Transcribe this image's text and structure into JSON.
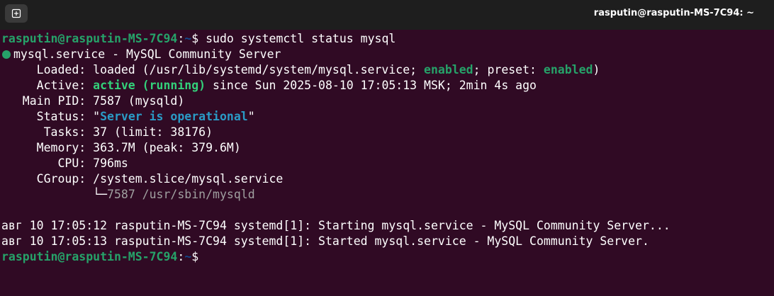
{
  "window": {
    "title": "rasputin@rasputin-MS-7C94: ~"
  },
  "prompt": {
    "user_host": "rasputin@rasputin-MS-7C94",
    "separator": ":",
    "path": "~",
    "symbol": "$"
  },
  "command": " sudo systemctl status mysql",
  "status": {
    "unit_line": "mysql.service - MySQL Community Server",
    "loaded_label": "     Loaded: ",
    "loaded_prefix": "loaded (/usr/lib/systemd/system/mysql.service; ",
    "loaded_enabled": "enabled",
    "loaded_mid": "; preset: ",
    "loaded_preset": "enabled",
    "loaded_suffix": ")",
    "active_label": "     Active: ",
    "active_value": "active (running)",
    "active_suffix": " since Sun 2025-08-10 17:05:13 MSK; 2min 4s ago",
    "main_pid_line": "   Main PID: 7587 (mysqld)",
    "status_label": "     Status: ",
    "status_quote_open": "\"",
    "status_value": "Server is operational",
    "status_quote_close": "\"",
    "tasks_line": "      Tasks: 37 (limit: 38176)",
    "memory_line": "     Memory: 363.7M (peak: 379.6M)",
    "cpu_line": "        CPU: 796ms",
    "cgroup_line": "     CGroup: /system.slice/mysql.service",
    "cgroup_indent": "             ",
    "cgroup_tree": "└─",
    "cgroup_process": "7587 /usr/sbin/mysqld"
  },
  "log": [
    "авг 10 17:05:12 rasputin-MS-7C94 systemd[1]: Starting mysql.service - MySQL Community Server...",
    "авг 10 17:05:13 rasputin-MS-7C94 systemd[1]: Started mysql.service - MySQL Community Server."
  ],
  "colors": {
    "background": "#300a24",
    "titlebar": "#1e1e1e",
    "prompt_user": "#26a269",
    "prompt_path": "#12488b",
    "active_green": "#33d17a",
    "status_cyan": "#2a9bc6"
  },
  "icons": {
    "new_tab": "new-tab-icon",
    "status_dot": "status-dot-icon"
  }
}
